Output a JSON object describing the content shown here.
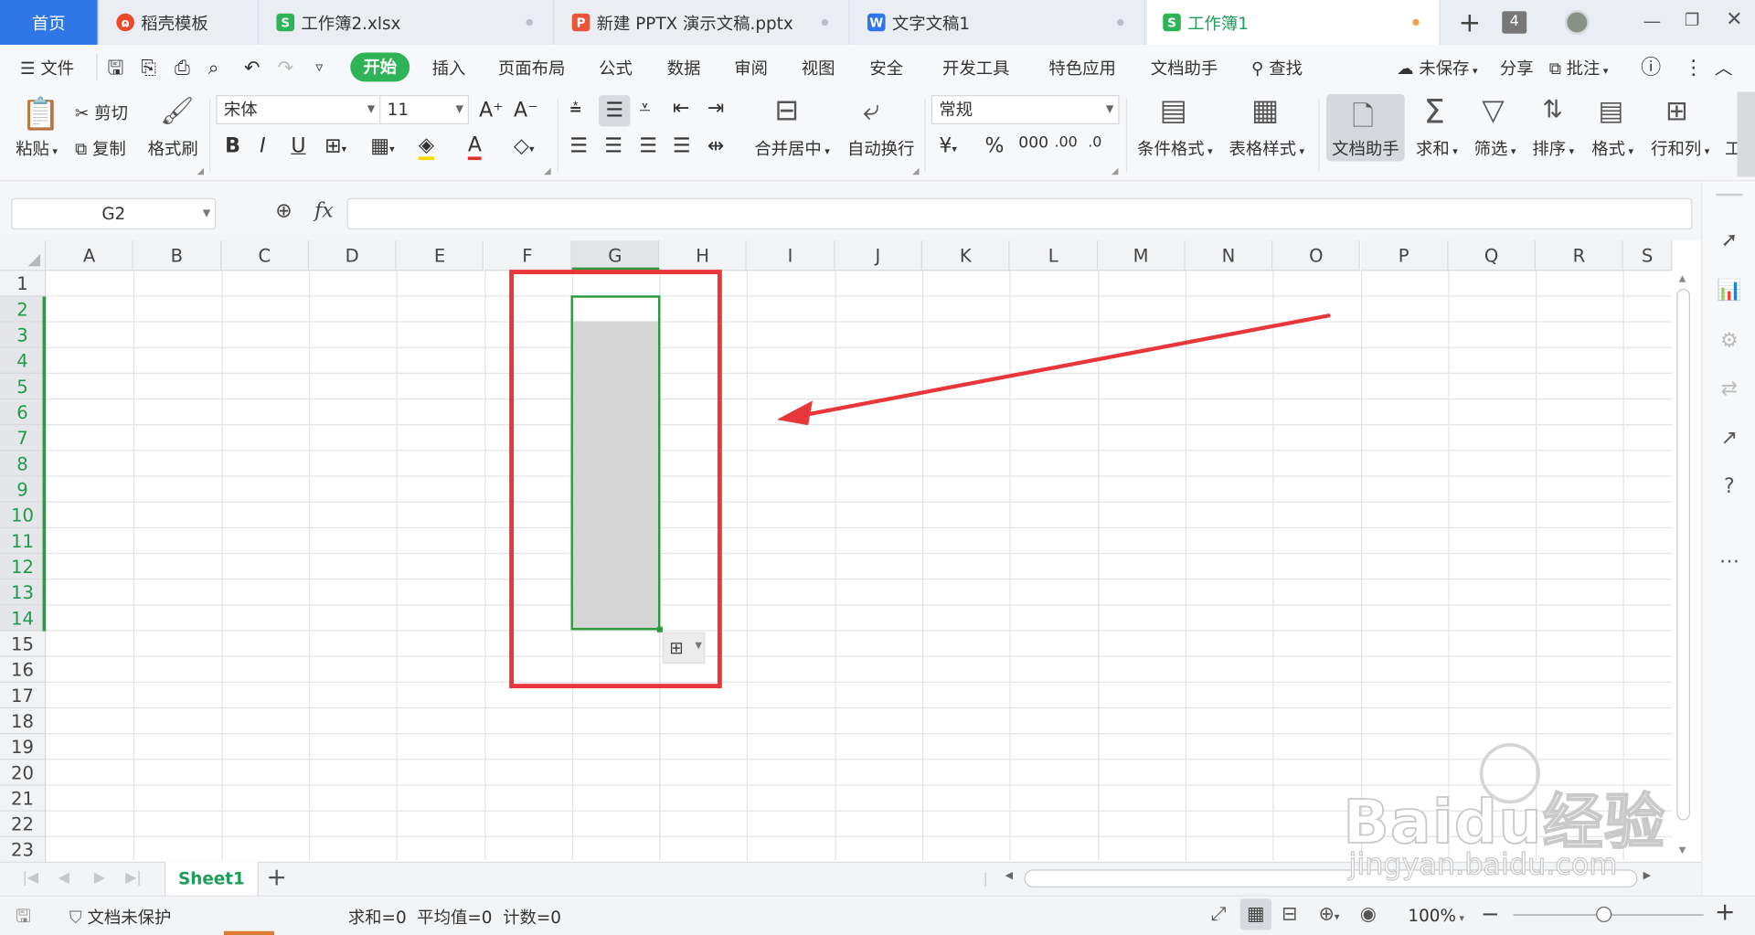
{
  "tabs": [
    {
      "label": "首页"
    },
    {
      "label": "稻壳模板",
      "icon": "daoke-icon"
    },
    {
      "label": "工作簿2.xlsx",
      "icon": "spreadsheet-icon"
    },
    {
      "label": "新建 PPTX 演示文稿.pptx",
      "icon": "presentation-icon"
    },
    {
      "label": "文字文稿1",
      "icon": "document-icon"
    },
    {
      "label": "工作簿1",
      "icon": "spreadsheet-icon"
    }
  ],
  "window": {
    "count_badge": "4",
    "plus": "+"
  },
  "menu": {
    "file": "文件",
    "items": [
      "开始",
      "插入",
      "页面布局",
      "公式",
      "数据",
      "审阅",
      "视图",
      "安全",
      "开发工具",
      "特色应用",
      "文档助手"
    ],
    "search": "查找",
    "unsaved": "未保存",
    "share": "分享",
    "comment": "批注"
  },
  "ribbon": {
    "paste": "粘贴",
    "cut": "剪切",
    "copy": "复制",
    "format_painter": "格式刷",
    "font_name": "宋体",
    "font_size": "11",
    "bold": "B",
    "italic": "I",
    "underline": "U",
    "merge_center": "合并居中",
    "wrap_text": "自动换行",
    "number_format": "常规",
    "conditional_format": "条件格式",
    "table_style": "表格样式",
    "doc_helper": "文档助手",
    "sum": "求和",
    "filter": "筛选",
    "sort": "排序",
    "format": "格式",
    "rows_cols": "行和列",
    "more": "工"
  },
  "formula_bar": {
    "name_box": "G2",
    "fx": "fx",
    "formula": ""
  },
  "grid": {
    "columns": [
      "A",
      "B",
      "C",
      "D",
      "E",
      "F",
      "G",
      "H",
      "I",
      "J",
      "K",
      "L",
      "M",
      "N",
      "O",
      "P",
      "Q",
      "R",
      "S"
    ],
    "rows": [
      "1",
      "2",
      "3",
      "4",
      "5",
      "6",
      "7",
      "8",
      "9",
      "10",
      "11",
      "12",
      "13",
      "14",
      "15",
      "16",
      "17",
      "18",
      "19",
      "20",
      "21",
      "22",
      "23"
    ],
    "selected_column": "G",
    "selected_range": "G2:G14",
    "active_cell": "G2"
  },
  "sheets": {
    "active": "Sheet1",
    "add": "+"
  },
  "status": {
    "protection": "文档未保护",
    "stats": "求和=0  平均值=0  计数=0",
    "zoom": "100%",
    "minus": "−",
    "plus": "+"
  },
  "watermark": {
    "brand": "Baidu经验",
    "url": "jingyan.baidu.com"
  },
  "colors": {
    "accent_green": "#2eb356",
    "selection_border": "#2d9a3f",
    "annotation_red": "#e8373a",
    "home_tab_blue": "#2f77e6"
  }
}
